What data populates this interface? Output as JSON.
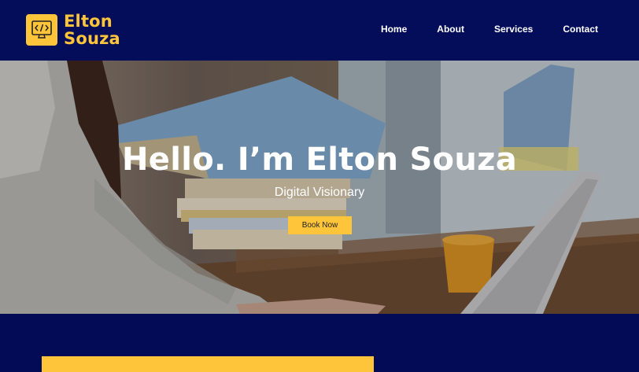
{
  "brand": {
    "name_line1": "Elton",
    "name_line2": "Souza",
    "logo_icon": "code-monitor-icon",
    "accent_color": "#ffc53a",
    "background_color": "#040d5a"
  },
  "nav": {
    "items": [
      {
        "label": "Home"
      },
      {
        "label": "About"
      },
      {
        "label": "Services"
      },
      {
        "label": "Contact"
      }
    ]
  },
  "hero": {
    "title": "Hello. I’m Elton Souza",
    "subtitle": "Digital Visionary",
    "cta_label": "Book Now"
  }
}
